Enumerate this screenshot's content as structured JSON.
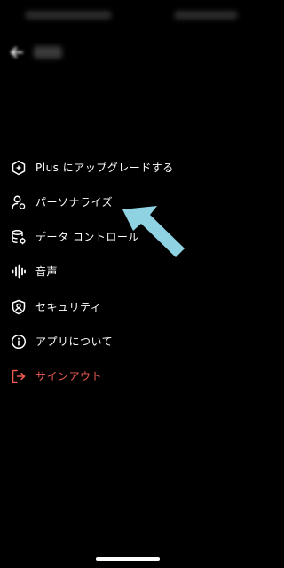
{
  "menu": {
    "items": [
      {
        "label": "Plus にアップグレードする",
        "icon": "upgrade-hex-icon"
      },
      {
        "label": "パーソナライズ",
        "icon": "personalize-user-icon"
      },
      {
        "label": "データ コントロール",
        "icon": "database-settings-icon"
      },
      {
        "label": "音声",
        "icon": "voice-waveform-icon"
      },
      {
        "label": "セキュリティ",
        "icon": "security-shield-icon"
      },
      {
        "label": "アプリについて",
        "icon": "info-icon"
      },
      {
        "label": "サインアウト",
        "icon": "sign-out-icon"
      }
    ]
  },
  "colors": {
    "background": "#000000",
    "text": "#ffffff",
    "danger": "#ef5b53",
    "arrow": "#8fd3e3"
  }
}
